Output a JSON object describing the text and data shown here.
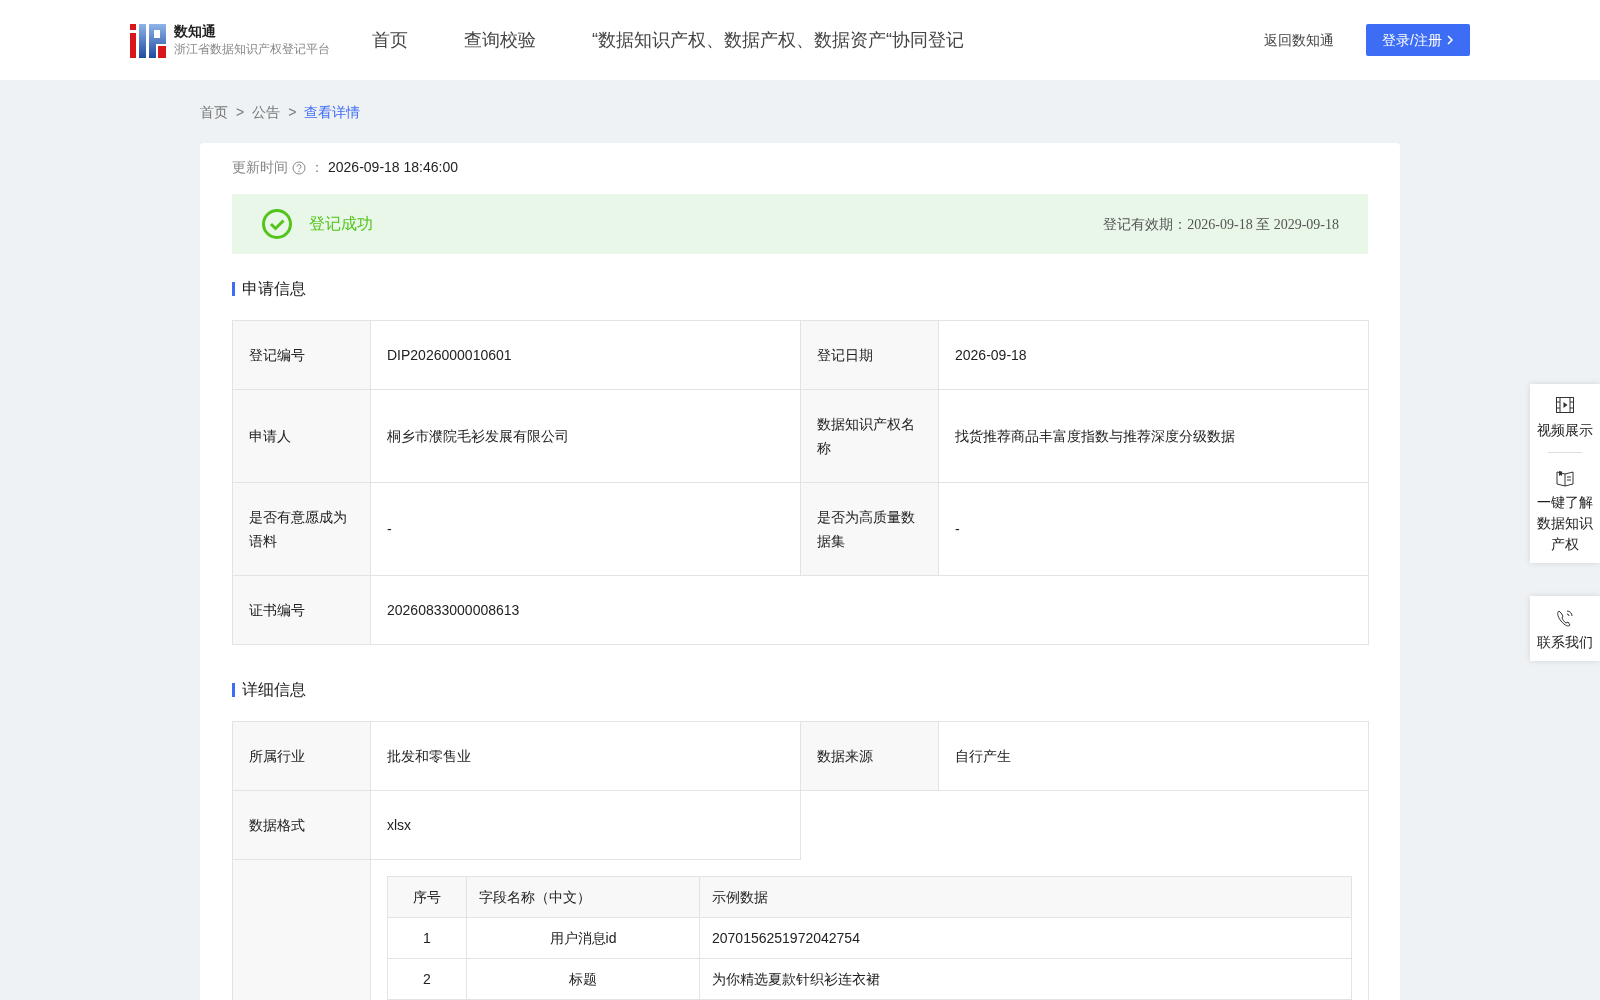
{
  "header": {
    "logo": {
      "title": "数知通",
      "subtitle": "浙江省数据知识产权登记平台"
    },
    "nav": [
      "首页",
      "查询校验",
      "“数据知识产权、数据产权、数据资产“协同登记"
    ],
    "back_link": "返回数知通",
    "login_button": "登录/注册"
  },
  "breadcrumb": [
    {
      "kind": "link",
      "label": "首页",
      "current": false
    },
    {
      "kind": "separator",
      "label": ">"
    },
    {
      "kind": "link",
      "label": "公告",
      "current": false
    },
    {
      "kind": "separator",
      "label": ">"
    },
    {
      "kind": "link",
      "label": "查看详情",
      "current": true
    }
  ],
  "update": {
    "label": "更新时间",
    "separator": "：",
    "value": "2026-09-18 18:46:00"
  },
  "status": {
    "text": "登记成功",
    "success": true,
    "validity": "登记有效期：2026-09-18 至 2029-09-18"
  },
  "sections": [
    {
      "title": "申请信息",
      "rows": [
        [
          {
            "label": "登记编号",
            "value": "DIP2026000010601"
          },
          {
            "label": "登记日期",
            "value": "2026-09-18"
          }
        ],
        [
          {
            "label": "申请人",
            "value": "桐乡市濮院毛衫发展有限公司"
          },
          {
            "label": "数据知识产权名称",
            "value": "找货推荐商品丰富度指数与推荐深度分级数据"
          }
        ],
        [
          {
            "label": "是否有意愿成为语料",
            "value": "-"
          },
          {
            "label": "是否为高质量数据集",
            "value": "-"
          }
        ],
        [
          {
            "label": "证书编号",
            "value": "20260833000008613"
          }
        ]
      ]
    },
    {
      "title": "详细信息",
      "rows": [
        [
          {
            "label": "所属行业",
            "value": "批发和零售业"
          },
          {
            "label": "数据来源",
            "value": "自行产生"
          }
        ],
        [
          {
            "label": "数据格式",
            "value": "xlsx"
          }
        ]
      ],
      "field_table": {
        "columns": [
          "序号",
          "字段名称（中文）",
          "示例数据"
        ],
        "rows": [
          [
            "1",
            "用户消息id",
            "2070156251972042754"
          ],
          [
            "2",
            "标题",
            "为你精选夏款针织衫连衣裙"
          ]
        ]
      }
    }
  ],
  "side_panel": [
    {
      "items": [
        "视频展示",
        "一键了解数据知识产权"
      ]
    },
    {
      "items": [
        "联系我们"
      ]
    }
  ]
}
